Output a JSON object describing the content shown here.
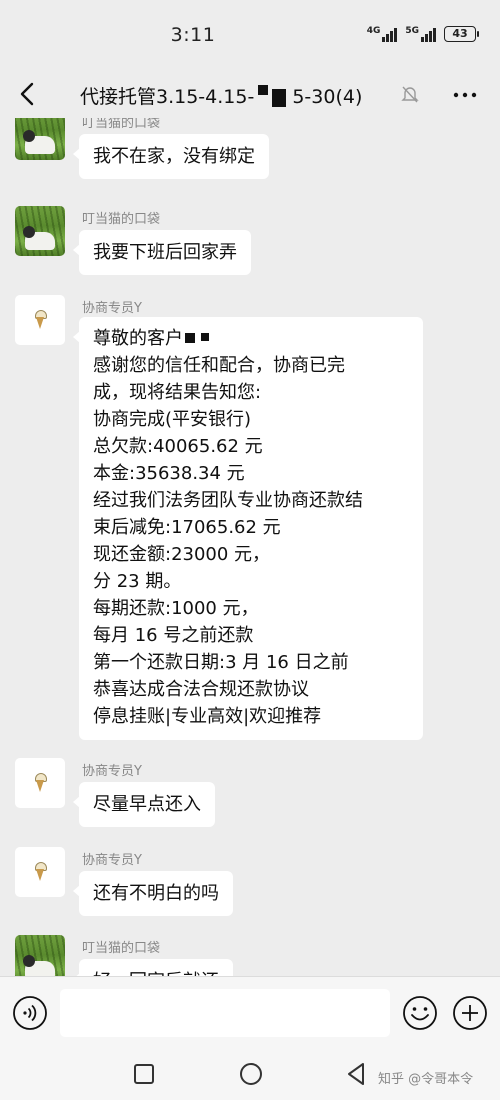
{
  "status": {
    "time": "3:11",
    "signal1": "4G",
    "signal2": "5G",
    "battery": "43"
  },
  "header": {
    "title_part1": "代接托管3.15-4.15-",
    "title_part2": "5-30(4)"
  },
  "messages": [
    {
      "sender": "叮当猫的口袋",
      "avatar": "grass-photo",
      "lines": [
        "我不在家，没有绑定"
      ]
    },
    {
      "sender": "叮当猫的口袋",
      "avatar": "grass-photo",
      "lines": [
        "我要下班后回家弄"
      ]
    },
    {
      "sender": "协商专员Y",
      "avatar": "ice-cream-cone",
      "lines": [
        "尊敬的客户",
        "感谢您的信任和配合，协商已完",
        "成，现将结果告知您:",
        "协商完成(平安银行)",
        "总欠款:40065.62 元",
        "本金:35638.34 元",
        "经过我们法务团队专业协商还款结",
        "束后减免:17065.62 元",
        "现还金额:23000 元，",
        "分 23 期。",
        "每期还款:1000 元，",
        "每月 16 号之前还款",
        "第一个还款日期:3 月 16 日之前",
        "恭喜达成合法合规还款协议",
        "停息挂账|专业高效|欢迎推荐"
      ]
    },
    {
      "sender": "协商专员Y",
      "avatar": "ice-cream-cone",
      "lines": [
        "尽量早点还入"
      ]
    },
    {
      "sender": "协商专员Y",
      "avatar": "ice-cream-cone",
      "lines": [
        "还有不明白的吗"
      ]
    },
    {
      "sender": "叮当猫的口袋",
      "avatar": "grass-photo",
      "lines": [
        "好，回家后就还"
      ]
    }
  ],
  "input": {
    "value": ""
  },
  "watermark": "知乎 @令哥本令",
  "icons": [
    "back-arrow-icon",
    "mute-bell-icon",
    "more-dots-icon",
    "voice-icon",
    "emoji-icon",
    "plus-icon",
    "nav-square-icon",
    "nav-home-icon",
    "nav-back-icon"
  ]
}
